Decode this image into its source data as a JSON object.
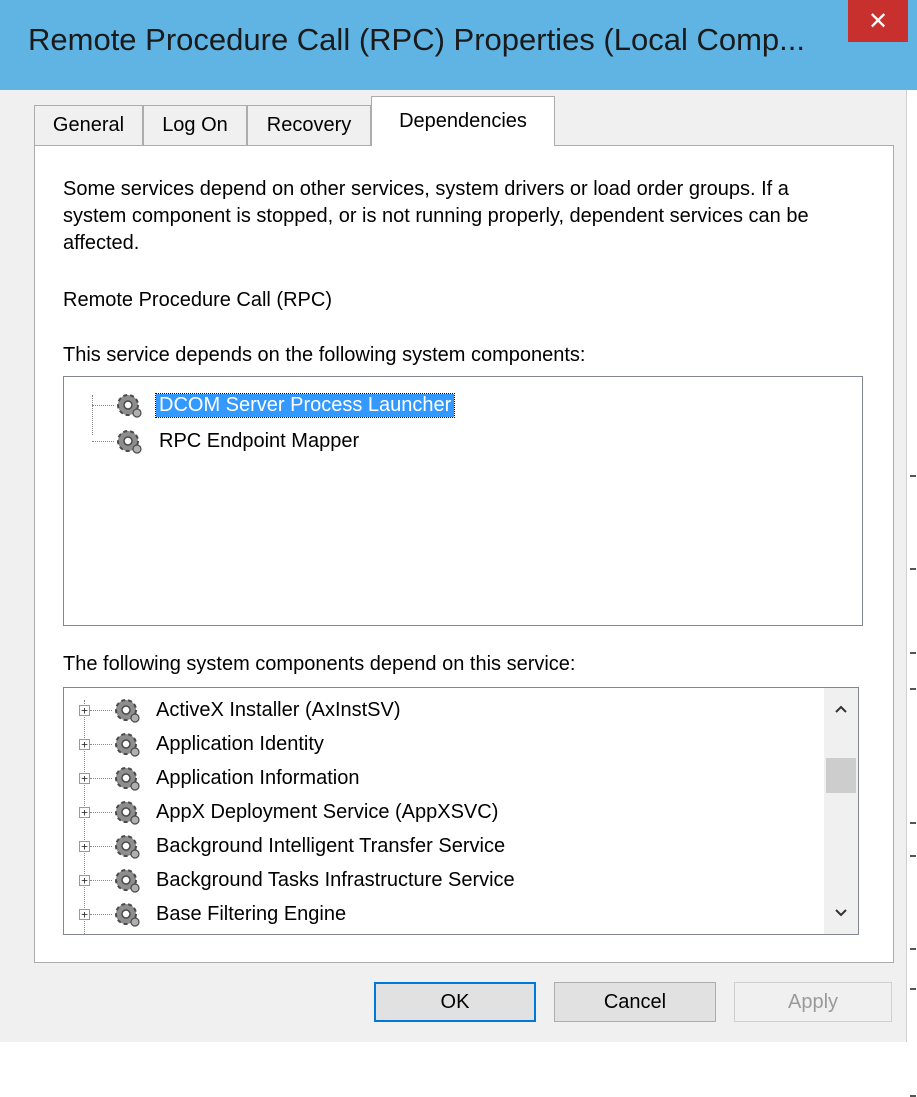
{
  "window": {
    "title": "Remote Procedure Call (RPC) Properties (Local Comp...",
    "close_label": "✕"
  },
  "tabs": [
    {
      "label": "General",
      "active": false
    },
    {
      "label": "Log On",
      "active": false
    },
    {
      "label": "Recovery",
      "active": false
    },
    {
      "label": "Dependencies",
      "active": true
    }
  ],
  "panel": {
    "description": "Some services depend on other services, system drivers or load order groups. If a system component is stopped, or is not running properly, dependent services can be affected.",
    "service_name": "Remote Procedure Call (RPC)",
    "depends_on_label": "This service depends on the following system components:",
    "dependents_label": "The following system components depend on this service:"
  },
  "depends_on": [
    {
      "label": "DCOM Server Process Launcher",
      "selected": true
    },
    {
      "label": "RPC Endpoint Mapper",
      "selected": false
    }
  ],
  "dependents": [
    {
      "label": "ActiveX Installer (AxInstSV)"
    },
    {
      "label": "Application Identity"
    },
    {
      "label": "Application Information"
    },
    {
      "label": "AppX Deployment Service (AppXSVC)"
    },
    {
      "label": "Background Intelligent Transfer Service"
    },
    {
      "label": "Background Tasks Infrastructure Service"
    },
    {
      "label": "Base Filtering Engine"
    }
  ],
  "scroll": {
    "up_icon": "chevron-up-icon",
    "down_icon": "chevron-down-icon"
  },
  "buttons": {
    "ok": "OK",
    "cancel": "Cancel",
    "apply": "Apply"
  },
  "colors": {
    "titlebar": "#5fb4e4",
    "close": "#c7302d",
    "selection": "#3399ff"
  }
}
